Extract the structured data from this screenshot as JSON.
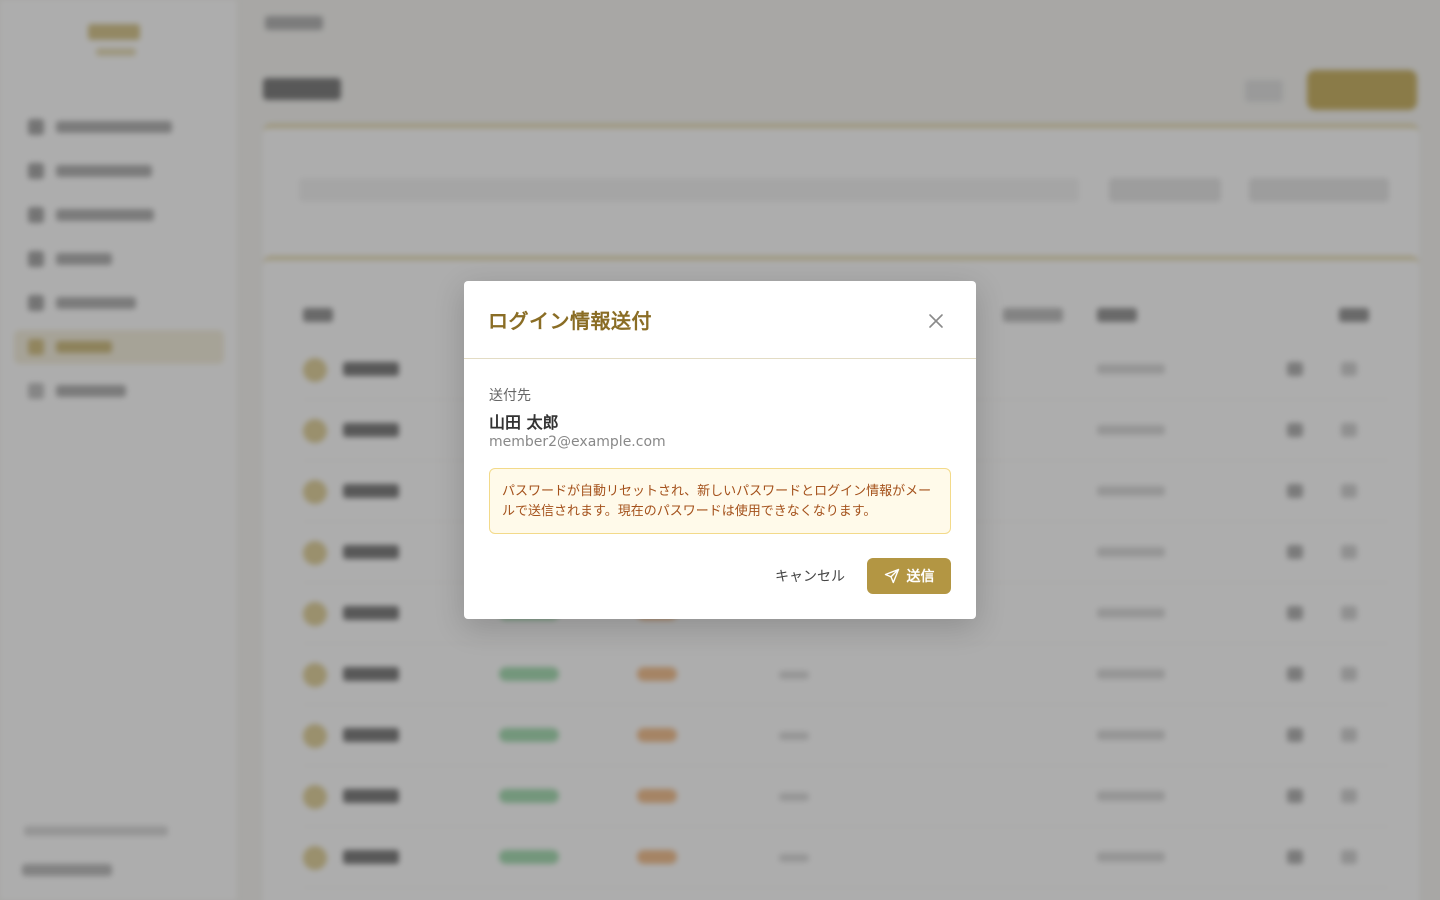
{
  "modal": {
    "title": "ログイン情報送付",
    "recipient_label": "送付先",
    "recipient_name": "山田 太郎",
    "recipient_email": "member2@example.com",
    "notice": "パスワードが自動リセットされ、新しいパスワードとログイン情報がメールで送信されます。現在のパスワードは使用できなくなります。",
    "cancel_label": "キャンセル",
    "send_label": "送信",
    "icons": {
      "close": "close-icon",
      "send": "send-icon"
    }
  },
  "colors": {
    "brand": "#b39643",
    "title": "#8a6d25",
    "notice_bg": "#fffaea",
    "notice_border": "#f3da8a",
    "notice_text": "#a4511b",
    "overlay": "rgba(92,92,92,0.5)"
  },
  "background": {
    "sidebar_item_count": 7,
    "active_sidebar_index": 5,
    "table_row_count": 9
  }
}
